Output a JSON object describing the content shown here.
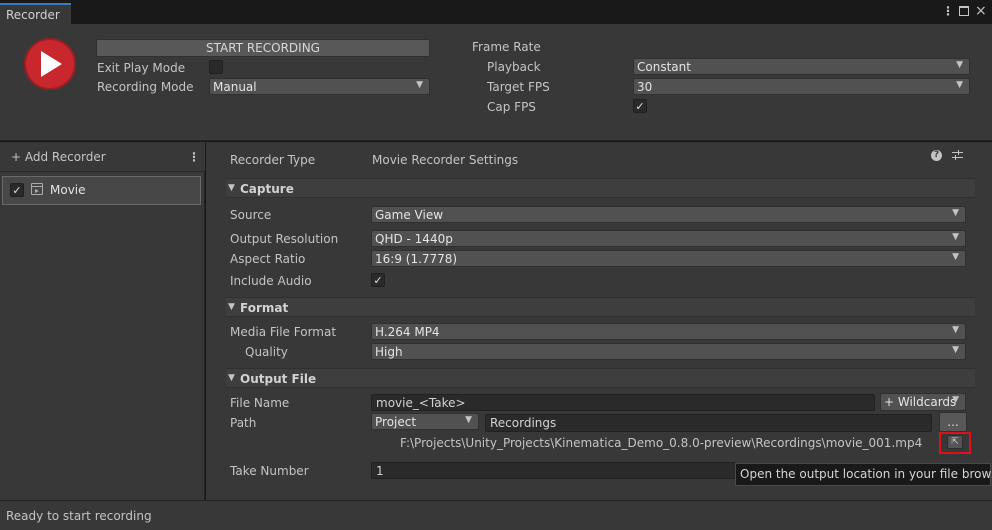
{
  "window": {
    "tab_title": "Recorder",
    "kebab": "⋮",
    "close": "×"
  },
  "top": {
    "start_button": "START RECORDING",
    "exit_play_mode_label": "Exit Play Mode",
    "recording_mode_label": "Recording Mode",
    "recording_mode_value": "Manual",
    "frame_rate_label": "Frame Rate",
    "playback_label": "Playback",
    "playback_value": "Constant",
    "target_fps_label": "Target FPS",
    "target_fps_value": "30",
    "cap_fps_label": "Cap FPS"
  },
  "left": {
    "add_recorder": "+ Add Recorder",
    "kebab": "⋮",
    "items": [
      {
        "label": "Movie",
        "checked": true
      }
    ]
  },
  "right": {
    "recorder_type_label": "Recorder Type",
    "recorder_type_value": "Movie Recorder Settings",
    "capture": {
      "title": "Capture",
      "source_label": "Source",
      "source_value": "Game View",
      "output_resolution_label": "Output Resolution",
      "output_resolution_value": "QHD - 1440p",
      "aspect_ratio_label": "Aspect Ratio",
      "aspect_ratio_value": "16:9 (1.7778)",
      "include_audio_label": "Include Audio"
    },
    "format": {
      "title": "Format",
      "media_file_format_label": "Media File Format",
      "media_file_format_value": "H.264 MP4",
      "quality_label": "Quality",
      "quality_value": "High"
    },
    "output_file": {
      "title": "Output File",
      "file_name_label": "File Name",
      "file_name_value": "movie_<Take>",
      "wildcards_button": "+ Wildcards",
      "path_label": "Path",
      "path_root_value": "Project",
      "path_value": "Recordings",
      "browse_button": "...",
      "full_path": "F:\\Projects\\Unity_Projects\\Kinematica_Demo_0.8.0-preview\\Recordings\\movie_001.mp4",
      "take_number_label": "Take Number",
      "take_number_value": "1"
    },
    "tooltip": "Open the output location in your file browser"
  },
  "status": "Ready to start recording",
  "colors": {
    "accent": "#3a79bb",
    "record": "#c8282d",
    "highlight": "#e0101a"
  }
}
